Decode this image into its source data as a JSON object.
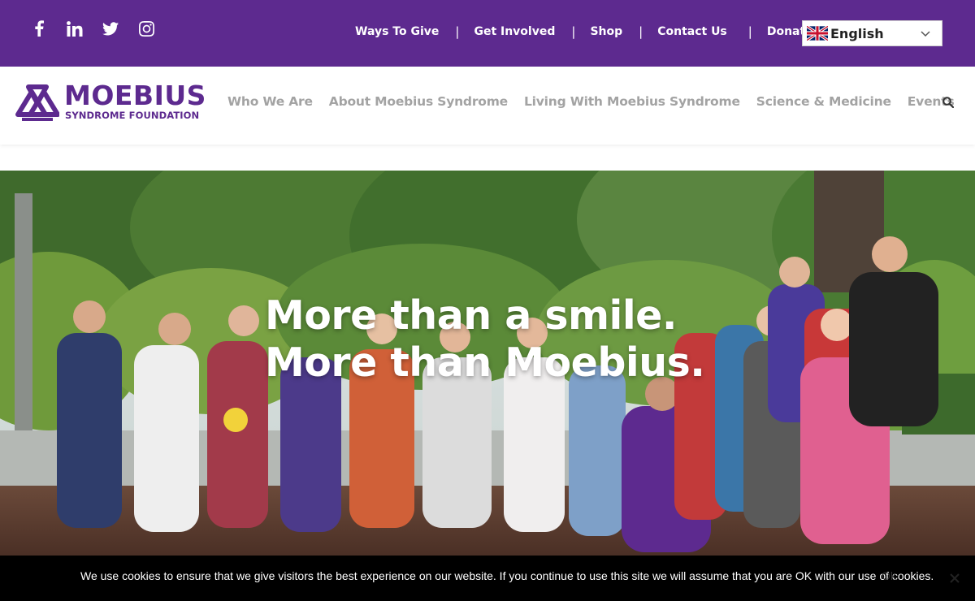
{
  "social": {
    "icons": [
      "facebook-icon",
      "linkedin-icon",
      "twitter-icon",
      "instagram-icon"
    ]
  },
  "topnav": {
    "links": [
      "Ways To Give",
      "Get Involved",
      "Shop",
      "Contact Us",
      "Donate"
    ],
    "separator": "|"
  },
  "language": {
    "selected": "English",
    "flag_icon": "uk-flag-icon"
  },
  "logo": {
    "line1": "MOEBIUS",
    "line2": "SYNDROME FOUNDATION"
  },
  "mainnav": {
    "links": [
      "Who We Are",
      "About Moebius Syndrome",
      "Living With Moebius Syndrome",
      "Science & Medicine",
      "Events"
    ]
  },
  "hero": {
    "line1": "More than a smile.",
    "line2": "More than Moebius."
  },
  "cookie": {
    "message": "We use cookies to ensure that we give visitors the best experience on our website. If you continue to use this site we will assume that you are OK with our use of cookies.",
    "ok": "Ok"
  },
  "colors": {
    "brand_purple": "#5d2a8f",
    "nav_gray": "#a3a3a3",
    "cookie_bg": "#000000"
  }
}
